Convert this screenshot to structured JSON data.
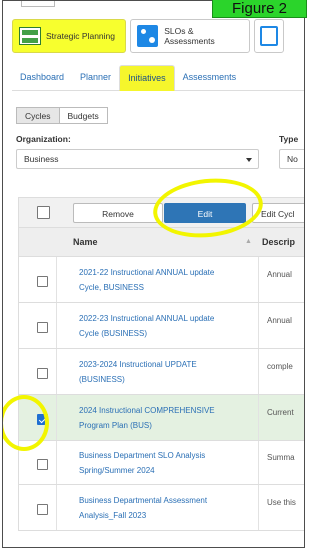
{
  "figure_label": "Figure 2",
  "app_tabs": [
    {
      "label": "Strategic Planning",
      "highlighted": true,
      "icon": "planning-icon"
    },
    {
      "label": "SLOs & Assessments",
      "highlighted": false,
      "icon": "slo-icon"
    }
  ],
  "nav": {
    "items": [
      {
        "label": "Dashboard",
        "active": false
      },
      {
        "label": "Planner",
        "active": false
      },
      {
        "label": "Initiatives",
        "active": true
      },
      {
        "label": "Assessments",
        "active": false
      }
    ]
  },
  "segment": {
    "cycles": "Cycles",
    "budgets": "Budgets",
    "selected": "Cycles"
  },
  "filters": {
    "organization_label": "Organization:",
    "organization_value": "Business",
    "type_label": "Type",
    "type_value": "No"
  },
  "toolbar": {
    "remove": "Remove",
    "edit": "Edit",
    "edit_cycle": "Edit Cycl"
  },
  "table": {
    "columns": [
      "Name",
      "Descrip"
    ],
    "rows": [
      {
        "name": "2021-22 Instructional ANNUAL update Cycle, BUSINESS",
        "description": "Annual",
        "checked": false
      },
      {
        "name": "2022-23 Instructional ANNUAL update Cycle (BUSINESS)",
        "description": "Annual",
        "checked": false
      },
      {
        "name": "2023-2024 Instructional UPDATE (BUSINESS)",
        "description": "comple",
        "checked": false
      },
      {
        "name": "2024 Instructional COMPREHENSIVE Program Plan (BUS)",
        "description": "Current",
        "checked": true
      },
      {
        "name": "Business Department SLO Analysis Spring/Summer 2024",
        "description": "Summa",
        "checked": false
      },
      {
        "name": "Business Departmental Assessment Analysis_Fall 2023",
        "description": "Use this",
        "checked": false
      }
    ]
  },
  "colors": {
    "highlight": "#f5f62c",
    "accent": "#2e75b6",
    "selected_row": "#e4f1e1",
    "figure_label_bg": "#2bd42b"
  }
}
